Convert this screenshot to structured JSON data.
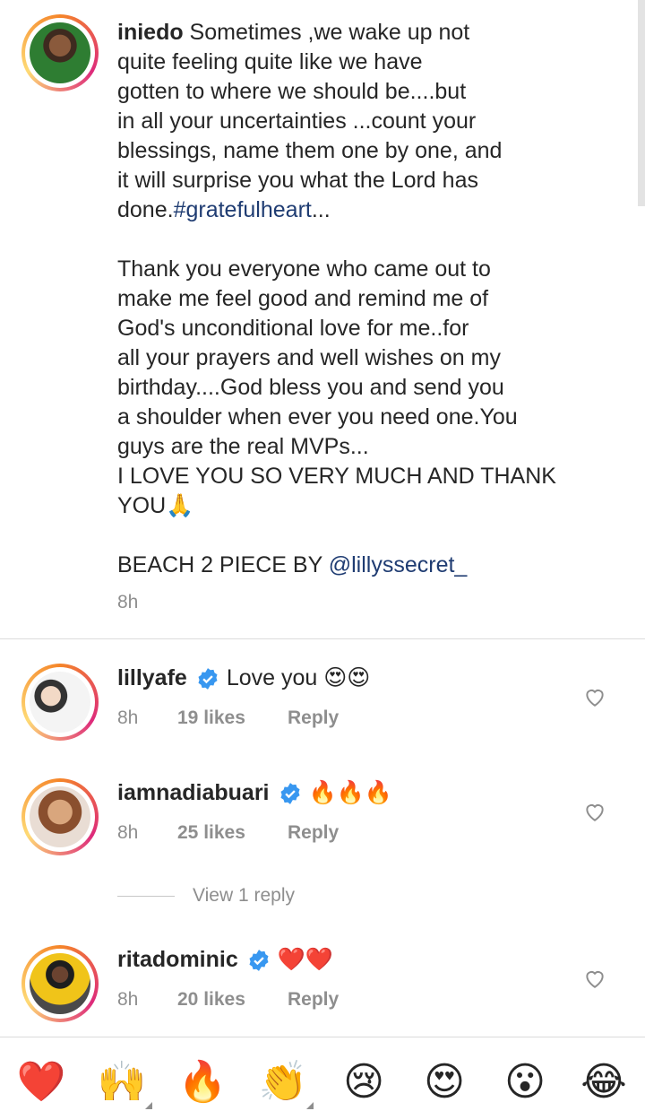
{
  "caption": {
    "username": "iniedo",
    "text_part1": " Sometimes ,we wake up not\nquite feeling quite  like we have\ngotten to where we should be....but\nin all your uncertainties ...count your\nblessings, name them one by one, and\nit will surprise you what the Lord has\ndone.",
    "hashtag": "#gratefulheart",
    "text_part2": "...\n\nThank you everyone who came out to\nmake me feel good and remind me of\nGod's unconditional love for me..for\nall your prayers and well wishes on my\nbirthday....God bless you and send you\na shoulder when ever you need one.You\nguys are the real MVPs...\nI LOVE YOU SO VERY MUCH AND THANK\nYOU🙏\n\nBEACH 2 PIECE BY ",
    "mention": "@lillyssecret_",
    "time": "8h"
  },
  "comments": [
    {
      "username": "lillyafe",
      "verified": true,
      "text": "Love you 😍😍",
      "time": "8h",
      "likes": "19 likes",
      "reply_label": "Reply"
    },
    {
      "username": "iamnadiabuari",
      "verified": true,
      "text": "🔥🔥🔥",
      "time": "8h",
      "likes": "25 likes",
      "reply_label": "Reply",
      "view_replies": "View 1 reply"
    },
    {
      "username": "ritadominic",
      "verified": true,
      "text": "❤️❤️",
      "time": "8h",
      "likes": "20 likes",
      "reply_label": "Reply"
    }
  ],
  "emoji_bar": [
    "❤️",
    "🙌",
    "🔥",
    "👏",
    "😢",
    "😍",
    "😮",
    "😂"
  ],
  "colors": {
    "link": "#1f3c72",
    "verified_blue": "#3897f0",
    "muted": "#8e8e8e"
  }
}
